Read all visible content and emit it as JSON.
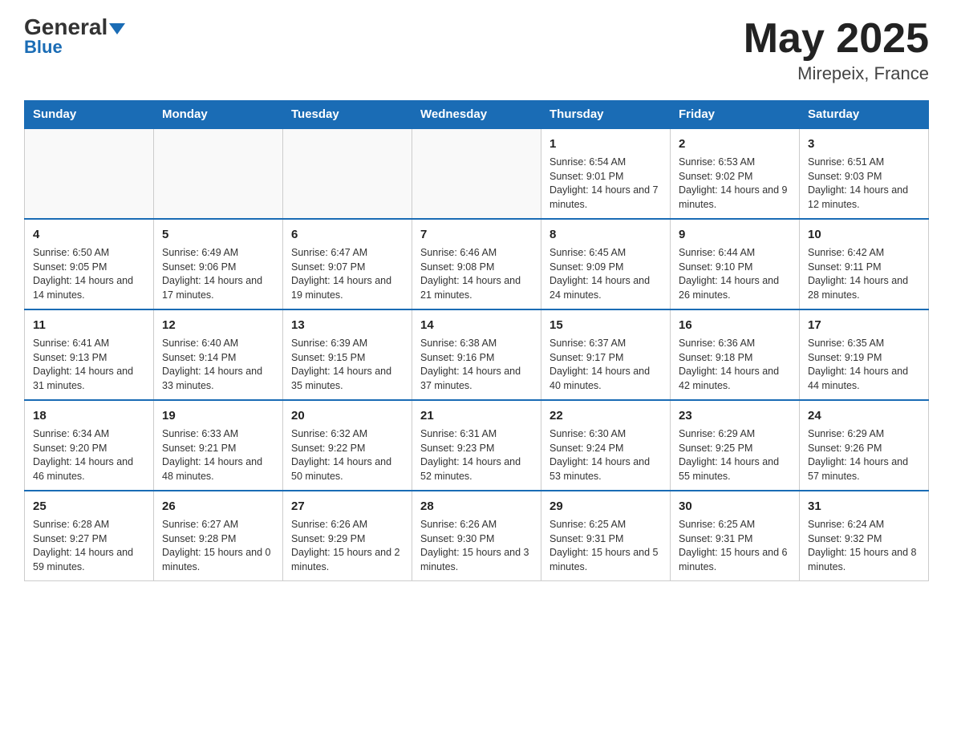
{
  "header": {
    "logo_main": "General",
    "logo_sub": "Blue",
    "month_year": "May 2025",
    "location": "Mirepeix, France"
  },
  "days_of_week": [
    "Sunday",
    "Monday",
    "Tuesday",
    "Wednesday",
    "Thursday",
    "Friday",
    "Saturday"
  ],
  "weeks": [
    [
      {
        "day": "",
        "info": ""
      },
      {
        "day": "",
        "info": ""
      },
      {
        "day": "",
        "info": ""
      },
      {
        "day": "",
        "info": ""
      },
      {
        "day": "1",
        "info": "Sunrise: 6:54 AM\nSunset: 9:01 PM\nDaylight: 14 hours and 7 minutes."
      },
      {
        "day": "2",
        "info": "Sunrise: 6:53 AM\nSunset: 9:02 PM\nDaylight: 14 hours and 9 minutes."
      },
      {
        "day": "3",
        "info": "Sunrise: 6:51 AM\nSunset: 9:03 PM\nDaylight: 14 hours and 12 minutes."
      }
    ],
    [
      {
        "day": "4",
        "info": "Sunrise: 6:50 AM\nSunset: 9:05 PM\nDaylight: 14 hours and 14 minutes."
      },
      {
        "day": "5",
        "info": "Sunrise: 6:49 AM\nSunset: 9:06 PM\nDaylight: 14 hours and 17 minutes."
      },
      {
        "day": "6",
        "info": "Sunrise: 6:47 AM\nSunset: 9:07 PM\nDaylight: 14 hours and 19 minutes."
      },
      {
        "day": "7",
        "info": "Sunrise: 6:46 AM\nSunset: 9:08 PM\nDaylight: 14 hours and 21 minutes."
      },
      {
        "day": "8",
        "info": "Sunrise: 6:45 AM\nSunset: 9:09 PM\nDaylight: 14 hours and 24 minutes."
      },
      {
        "day": "9",
        "info": "Sunrise: 6:44 AM\nSunset: 9:10 PM\nDaylight: 14 hours and 26 minutes."
      },
      {
        "day": "10",
        "info": "Sunrise: 6:42 AM\nSunset: 9:11 PM\nDaylight: 14 hours and 28 minutes."
      }
    ],
    [
      {
        "day": "11",
        "info": "Sunrise: 6:41 AM\nSunset: 9:13 PM\nDaylight: 14 hours and 31 minutes."
      },
      {
        "day": "12",
        "info": "Sunrise: 6:40 AM\nSunset: 9:14 PM\nDaylight: 14 hours and 33 minutes."
      },
      {
        "day": "13",
        "info": "Sunrise: 6:39 AM\nSunset: 9:15 PM\nDaylight: 14 hours and 35 minutes."
      },
      {
        "day": "14",
        "info": "Sunrise: 6:38 AM\nSunset: 9:16 PM\nDaylight: 14 hours and 37 minutes."
      },
      {
        "day": "15",
        "info": "Sunrise: 6:37 AM\nSunset: 9:17 PM\nDaylight: 14 hours and 40 minutes."
      },
      {
        "day": "16",
        "info": "Sunrise: 6:36 AM\nSunset: 9:18 PM\nDaylight: 14 hours and 42 minutes."
      },
      {
        "day": "17",
        "info": "Sunrise: 6:35 AM\nSunset: 9:19 PM\nDaylight: 14 hours and 44 minutes."
      }
    ],
    [
      {
        "day": "18",
        "info": "Sunrise: 6:34 AM\nSunset: 9:20 PM\nDaylight: 14 hours and 46 minutes."
      },
      {
        "day": "19",
        "info": "Sunrise: 6:33 AM\nSunset: 9:21 PM\nDaylight: 14 hours and 48 minutes."
      },
      {
        "day": "20",
        "info": "Sunrise: 6:32 AM\nSunset: 9:22 PM\nDaylight: 14 hours and 50 minutes."
      },
      {
        "day": "21",
        "info": "Sunrise: 6:31 AM\nSunset: 9:23 PM\nDaylight: 14 hours and 52 minutes."
      },
      {
        "day": "22",
        "info": "Sunrise: 6:30 AM\nSunset: 9:24 PM\nDaylight: 14 hours and 53 minutes."
      },
      {
        "day": "23",
        "info": "Sunrise: 6:29 AM\nSunset: 9:25 PM\nDaylight: 14 hours and 55 minutes."
      },
      {
        "day": "24",
        "info": "Sunrise: 6:29 AM\nSunset: 9:26 PM\nDaylight: 14 hours and 57 minutes."
      }
    ],
    [
      {
        "day": "25",
        "info": "Sunrise: 6:28 AM\nSunset: 9:27 PM\nDaylight: 14 hours and 59 minutes."
      },
      {
        "day": "26",
        "info": "Sunrise: 6:27 AM\nSunset: 9:28 PM\nDaylight: 15 hours and 0 minutes."
      },
      {
        "day": "27",
        "info": "Sunrise: 6:26 AM\nSunset: 9:29 PM\nDaylight: 15 hours and 2 minutes."
      },
      {
        "day": "28",
        "info": "Sunrise: 6:26 AM\nSunset: 9:30 PM\nDaylight: 15 hours and 3 minutes."
      },
      {
        "day": "29",
        "info": "Sunrise: 6:25 AM\nSunset: 9:31 PM\nDaylight: 15 hours and 5 minutes."
      },
      {
        "day": "30",
        "info": "Sunrise: 6:25 AM\nSunset: 9:31 PM\nDaylight: 15 hours and 6 minutes."
      },
      {
        "day": "31",
        "info": "Sunrise: 6:24 AM\nSunset: 9:32 PM\nDaylight: 15 hours and 8 minutes."
      }
    ]
  ]
}
